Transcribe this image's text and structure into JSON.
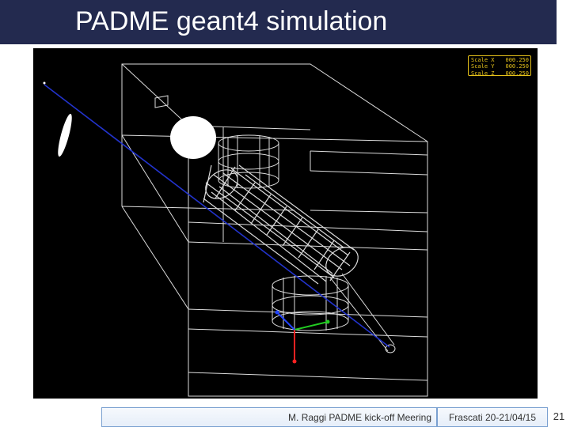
{
  "slide": {
    "title": "PADME geant4 simulation",
    "footer_author": "M. Raggi PADME kick-off Meering",
    "footer_place_date": "Frascati 20-21/04/15",
    "page_number": "21"
  },
  "viewer": {
    "scale": [
      {
        "label": "Scale X",
        "value": "000.250"
      },
      {
        "label": "Scale Y",
        "value": "000.250"
      },
      {
        "label": "Scale Z",
        "value": "000.250"
      }
    ]
  },
  "colors": {
    "title_bar": "#232a4f",
    "wireframe": "#ffffff",
    "beam_line": "#2233cc",
    "scale_text": "#e6c21a",
    "axis_x": "#22cc22",
    "axis_y": "#ff2222",
    "axis_z": "#2244ff"
  }
}
